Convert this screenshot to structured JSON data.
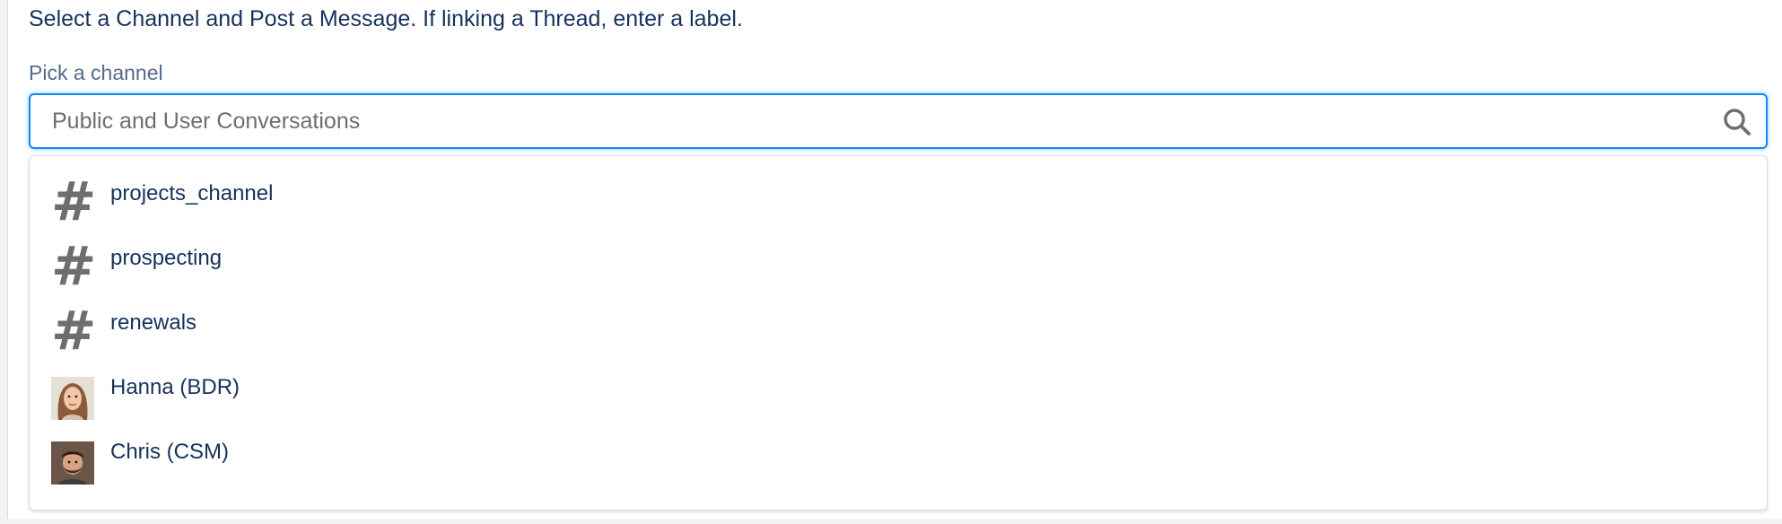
{
  "instructions": "Select a Channel and Post a Message. If linking a Thread, enter a label.",
  "channel_picker": {
    "label": "Pick a channel",
    "placeholder": "Public and User Conversations",
    "search_icon": "search-icon"
  },
  "options": [
    {
      "type": "channel",
      "icon": "hash-icon",
      "label": ""
    },
    {
      "type": "channel",
      "icon": "hash-icon",
      "label": "projects_channel"
    },
    {
      "type": "channel",
      "icon": "hash-icon",
      "label": "prospecting"
    },
    {
      "type": "channel",
      "icon": "hash-icon",
      "label": "renewals"
    },
    {
      "type": "user",
      "icon": "avatar",
      "label": "Hanna (BDR)"
    },
    {
      "type": "user",
      "icon": "avatar",
      "label": "Chris (CSM)"
    }
  ],
  "colors": {
    "text": "#16325c",
    "label": "#54698d",
    "focus_border": "#1589ee",
    "icon": "#706e6b"
  }
}
